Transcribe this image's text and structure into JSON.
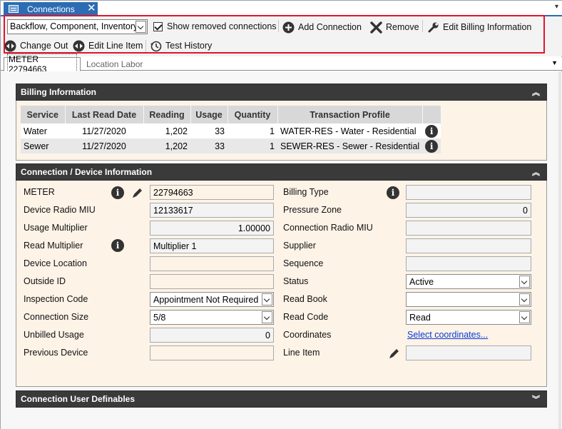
{
  "document_tab": {
    "title": "Connections",
    "close": "✕"
  },
  "toolbar": {
    "filter_combo_value": "Backflow, Component, Inventory",
    "show_removed_label": "Show removed connections",
    "add_connection": "Add Connection",
    "remove": "Remove",
    "edit_billing": "Edit Billing Information",
    "change_out": "Change Out",
    "edit_line_item": "Edit Line Item",
    "test_history": "Test History"
  },
  "page_tabs": {
    "active": "METER 22794663",
    "inactive": "Location Labor"
  },
  "billing": {
    "title": "Billing Information",
    "columns": [
      "Service",
      "Last Read Date",
      "Reading",
      "Usage",
      "Quantity",
      "Transaction Profile"
    ],
    "rows": [
      {
        "service": "Water",
        "last_read": "11/27/2020",
        "reading": "1,202",
        "usage": "33",
        "quantity": "1",
        "profile": "WATER-RES - Water - Residential"
      },
      {
        "service": "Sewer",
        "last_read": "11/27/2020",
        "reading": "1,202",
        "usage": "33",
        "quantity": "1",
        "profile": "SEWER-RES - Sewer - Residential"
      }
    ]
  },
  "connection": {
    "title": "Connection / Device Information",
    "left": {
      "meter_label": "METER",
      "meter_value": "22794663",
      "radio_miu_label": "Device Radio MIU",
      "radio_miu_value": "12133617",
      "usage_mult_label": "Usage Multiplier",
      "usage_mult_value": "1.00000",
      "read_mult_label": "Read Multiplier",
      "read_mult_value": "Multiplier 1",
      "location_label": "Device Location",
      "location_value": "",
      "outside_id_label": "Outside ID",
      "outside_id_value": "",
      "inspection_label": "Inspection Code",
      "inspection_value": "Appointment Not Required",
      "size_label": "Connection Size",
      "size_value": "5/8",
      "unbilled_label": "Unbilled Usage",
      "unbilled_value": "0",
      "prev_device_label": "Previous Device",
      "prev_device_value": ""
    },
    "right": {
      "billing_type_label": "Billing Type",
      "billing_type_value": "",
      "pressure_label": "Pressure Zone",
      "pressure_value": "0",
      "conn_radio_label": "Connection Radio MIU",
      "conn_radio_value": "",
      "supplier_label": "Supplier",
      "supplier_value": "",
      "sequence_label": "Sequence",
      "sequence_value": "",
      "status_label": "Status",
      "status_value": "Active",
      "read_book_label": "Read Book",
      "read_book_value": "",
      "read_code_label": "Read Code",
      "read_code_value": "Read",
      "coordinates_label": "Coordinates",
      "coordinates_link": "Select coordinates...",
      "line_item_label": "Line Item",
      "line_item_value": ""
    }
  },
  "user_definables": {
    "title": "Connection User Definables"
  },
  "icons": {
    "info": "i",
    "collapse": "⌃",
    "expand": "⌄"
  }
}
